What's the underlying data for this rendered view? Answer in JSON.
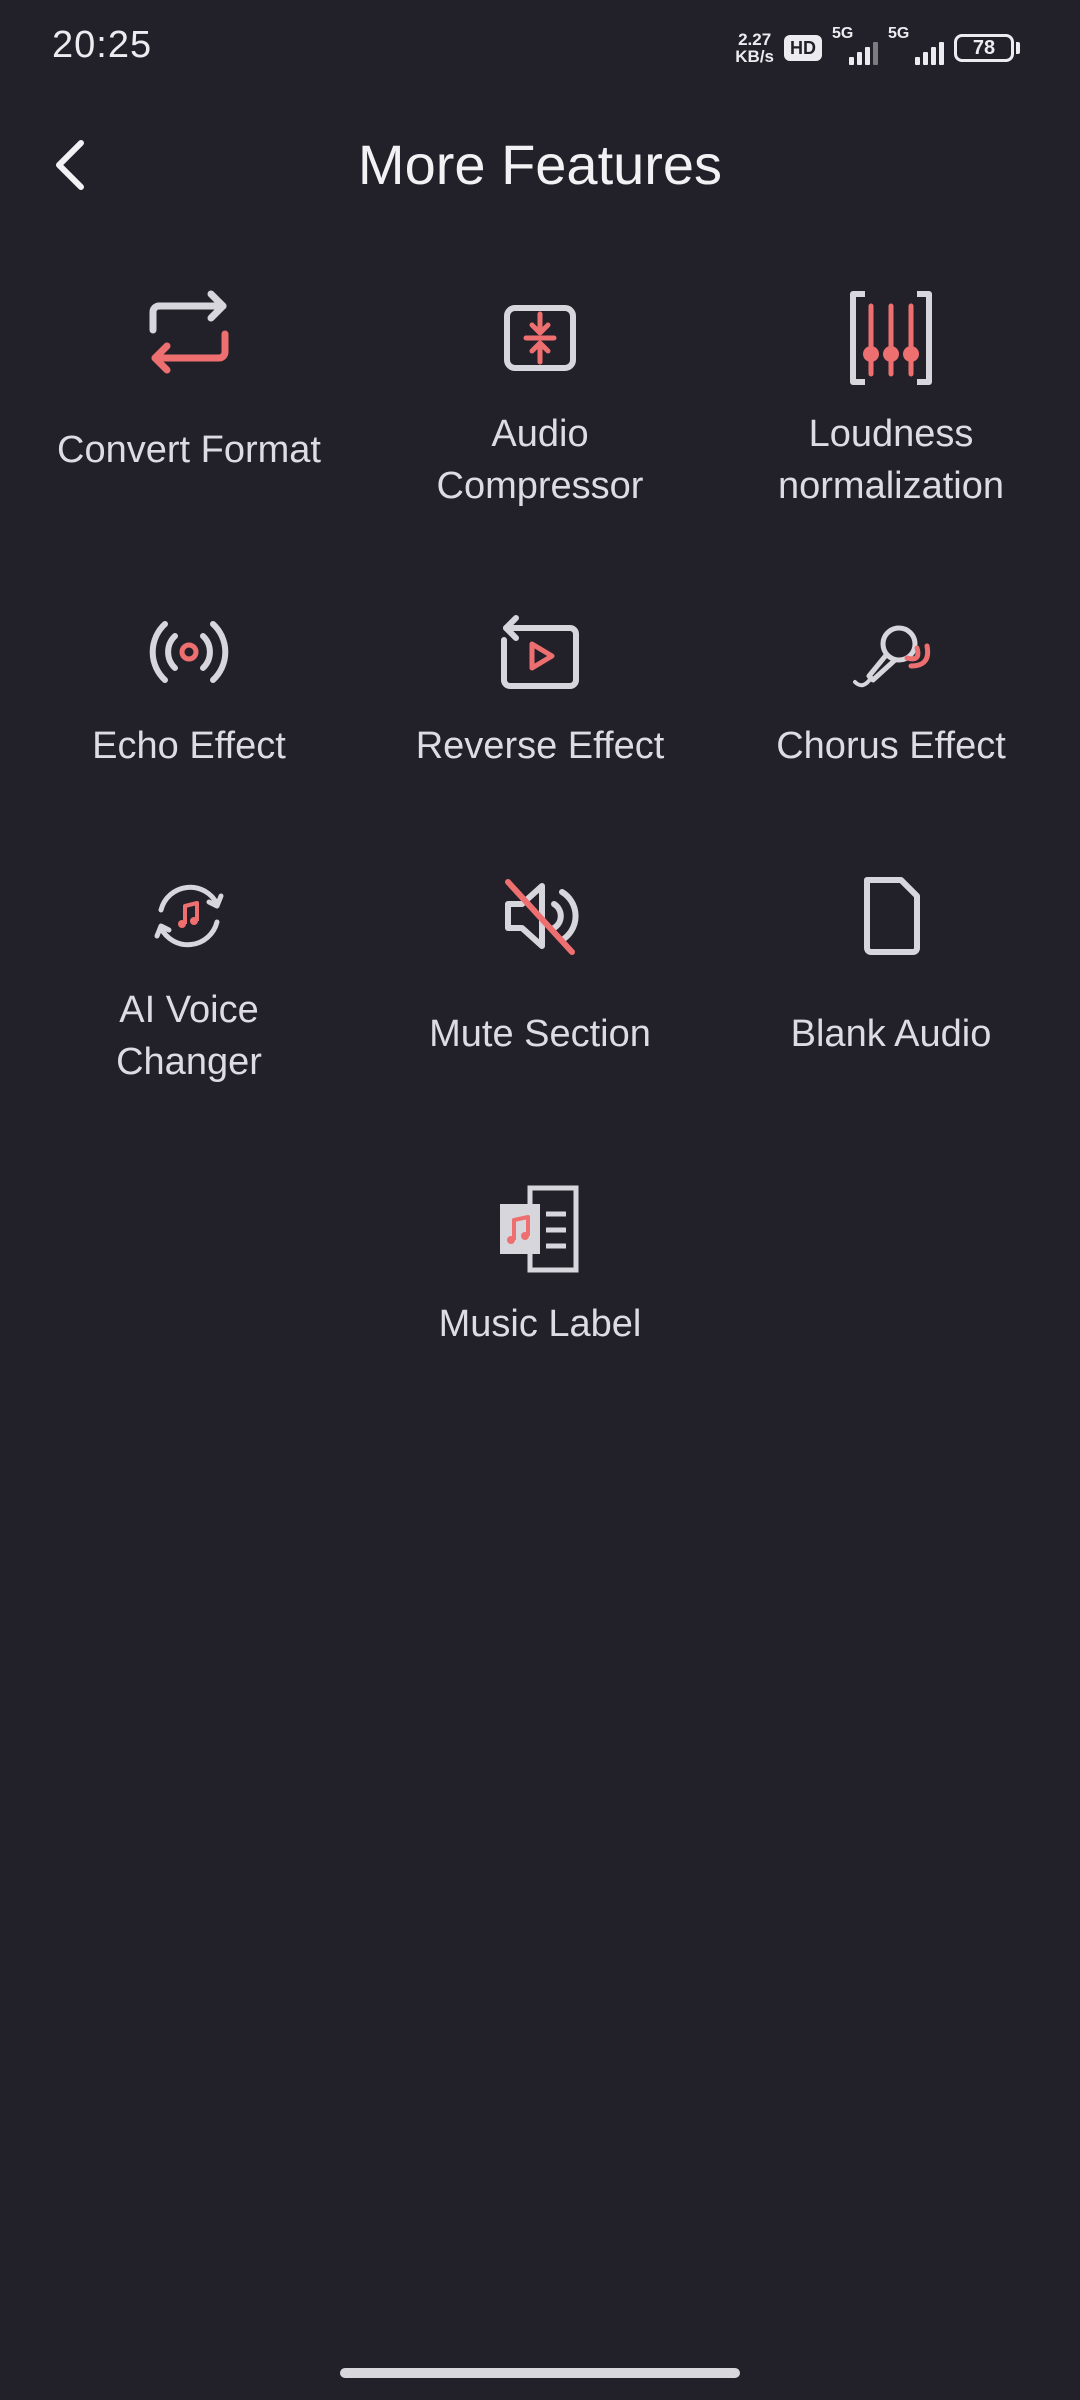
{
  "status_bar": {
    "time": "20:25",
    "net_speed_value": "2.27",
    "net_speed_unit": "KB/s",
    "hd_badge": "HD",
    "signal1_label": "5G",
    "signal2_label": "5G",
    "battery": "78"
  },
  "header": {
    "title": "More Features"
  },
  "features": [
    {
      "label": "Convert Format",
      "icon": "convert-format-icon"
    },
    {
      "label": "Audio Compressor",
      "icon": "audio-compressor-icon"
    },
    {
      "label": "Loudness normalization",
      "icon": "loudness-icon"
    },
    {
      "label": "Echo Effect",
      "icon": "echo-icon"
    },
    {
      "label": "Reverse Effect",
      "icon": "reverse-icon"
    },
    {
      "label": "Chorus Effect",
      "icon": "microphone-icon"
    },
    {
      "label": "AI Voice Changer",
      "icon": "voice-changer-icon"
    },
    {
      "label": "Mute Section",
      "icon": "mute-icon"
    },
    {
      "label": "Blank Audio",
      "icon": "blank-file-icon"
    },
    {
      "label": "Music Label",
      "icon": "music-label-icon"
    }
  ],
  "colors": {
    "background": "#22212a",
    "accent": "#ee6f6f",
    "icon_gray": "#d6d6dc"
  }
}
